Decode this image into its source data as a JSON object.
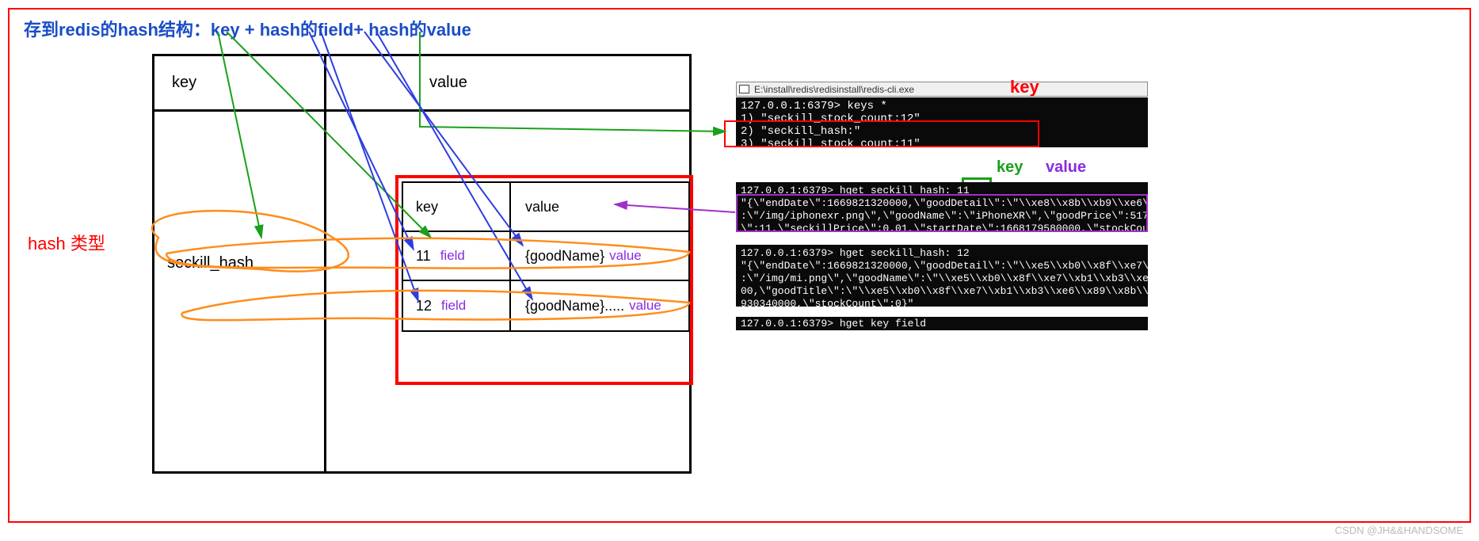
{
  "title": "存到redis的hash结构：key + hash的field+ hash的value",
  "hash_type_label": "hash 类型",
  "outer_table": {
    "header_key": "key",
    "header_value": "value",
    "key_value": "seckill_hash"
  },
  "inner_table": {
    "header_key": "key",
    "header_value": "value",
    "rows": [
      {
        "k": "11",
        "v": "{goodName}"
      },
      {
        "k": "12",
        "v": "{goodName}....."
      }
    ],
    "field_label": "field",
    "value_label": "value"
  },
  "terminal": {
    "window_title": "E:\\install\\redis\\redisinstall\\redis-cli.exe",
    "key_label": "key",
    "block1": "127.0.0.1:6379> keys *\n1) \"seckill_stock_count:12\"\n2) \"seckill_hash:\"\n3) \"seckill_stock_count:11\"",
    "mid_key_label": "key",
    "mid_value_label": "value",
    "block2": "127.0.0.1:6379> hget seckill_hash: 11\n\"{\\\"endDate\\\":1669821320000,\\\"goodDetail\\\":\\\"\\\\xe8\\\\x8b\\\\xb9\\\\xe6\\\\x9e\\\\x9c\\\\xe6\\\\x89\\\\x8\n:\\\"/img/iphonexr.png\\\",\\\"goodName\\\":\\\"iPhoneXR\\\",\\\"goodPrice\\\":5179.00,\\\"goodSto\n\\\":11,\\\"seckillPrice\\\":0.01,\\\"startDate\\\":1668179580000,\\\"stockCount\\\":8}\"",
    "block3": "127.0.0.1:6379> hget seckill_hash: 12\n\"{\\\"endDate\\\":1669821320000,\\\"goodDetail\\\":\\\"\\\\xe5\\\\xb0\\\\x8f\\\\xe7\\\\xb1\\\\xb3\\\\xe6\\\\x89\\\\x8\n:\\\"/img/mi.png\\\",\\\"goodName\\\":\\\"\\\\xe5\\\\xb0\\\\x8f\\\\xe7\\\\xb1\\\\xb3\\\\xe6\\\\x89\\\\x8b\\\\xe6\\\\x9c\\\\xba\n00,\\\"goodTitle\\\":\\\"\\\\xe5\\\\xb0\\\\x8f\\\\xe7\\\\xb1\\\\xb3\\\\xe6\\\\x89\\\\x8b\\\\xe6\\\\x9c\\\\xba\\\",\\\"id\\\":12,\n930340000,\\\"stockCount\\\":0}\"",
    "block4": "127.0.0.1:6379> hget key field"
  },
  "watermark": "CSDN @JH&&HANDSOME"
}
